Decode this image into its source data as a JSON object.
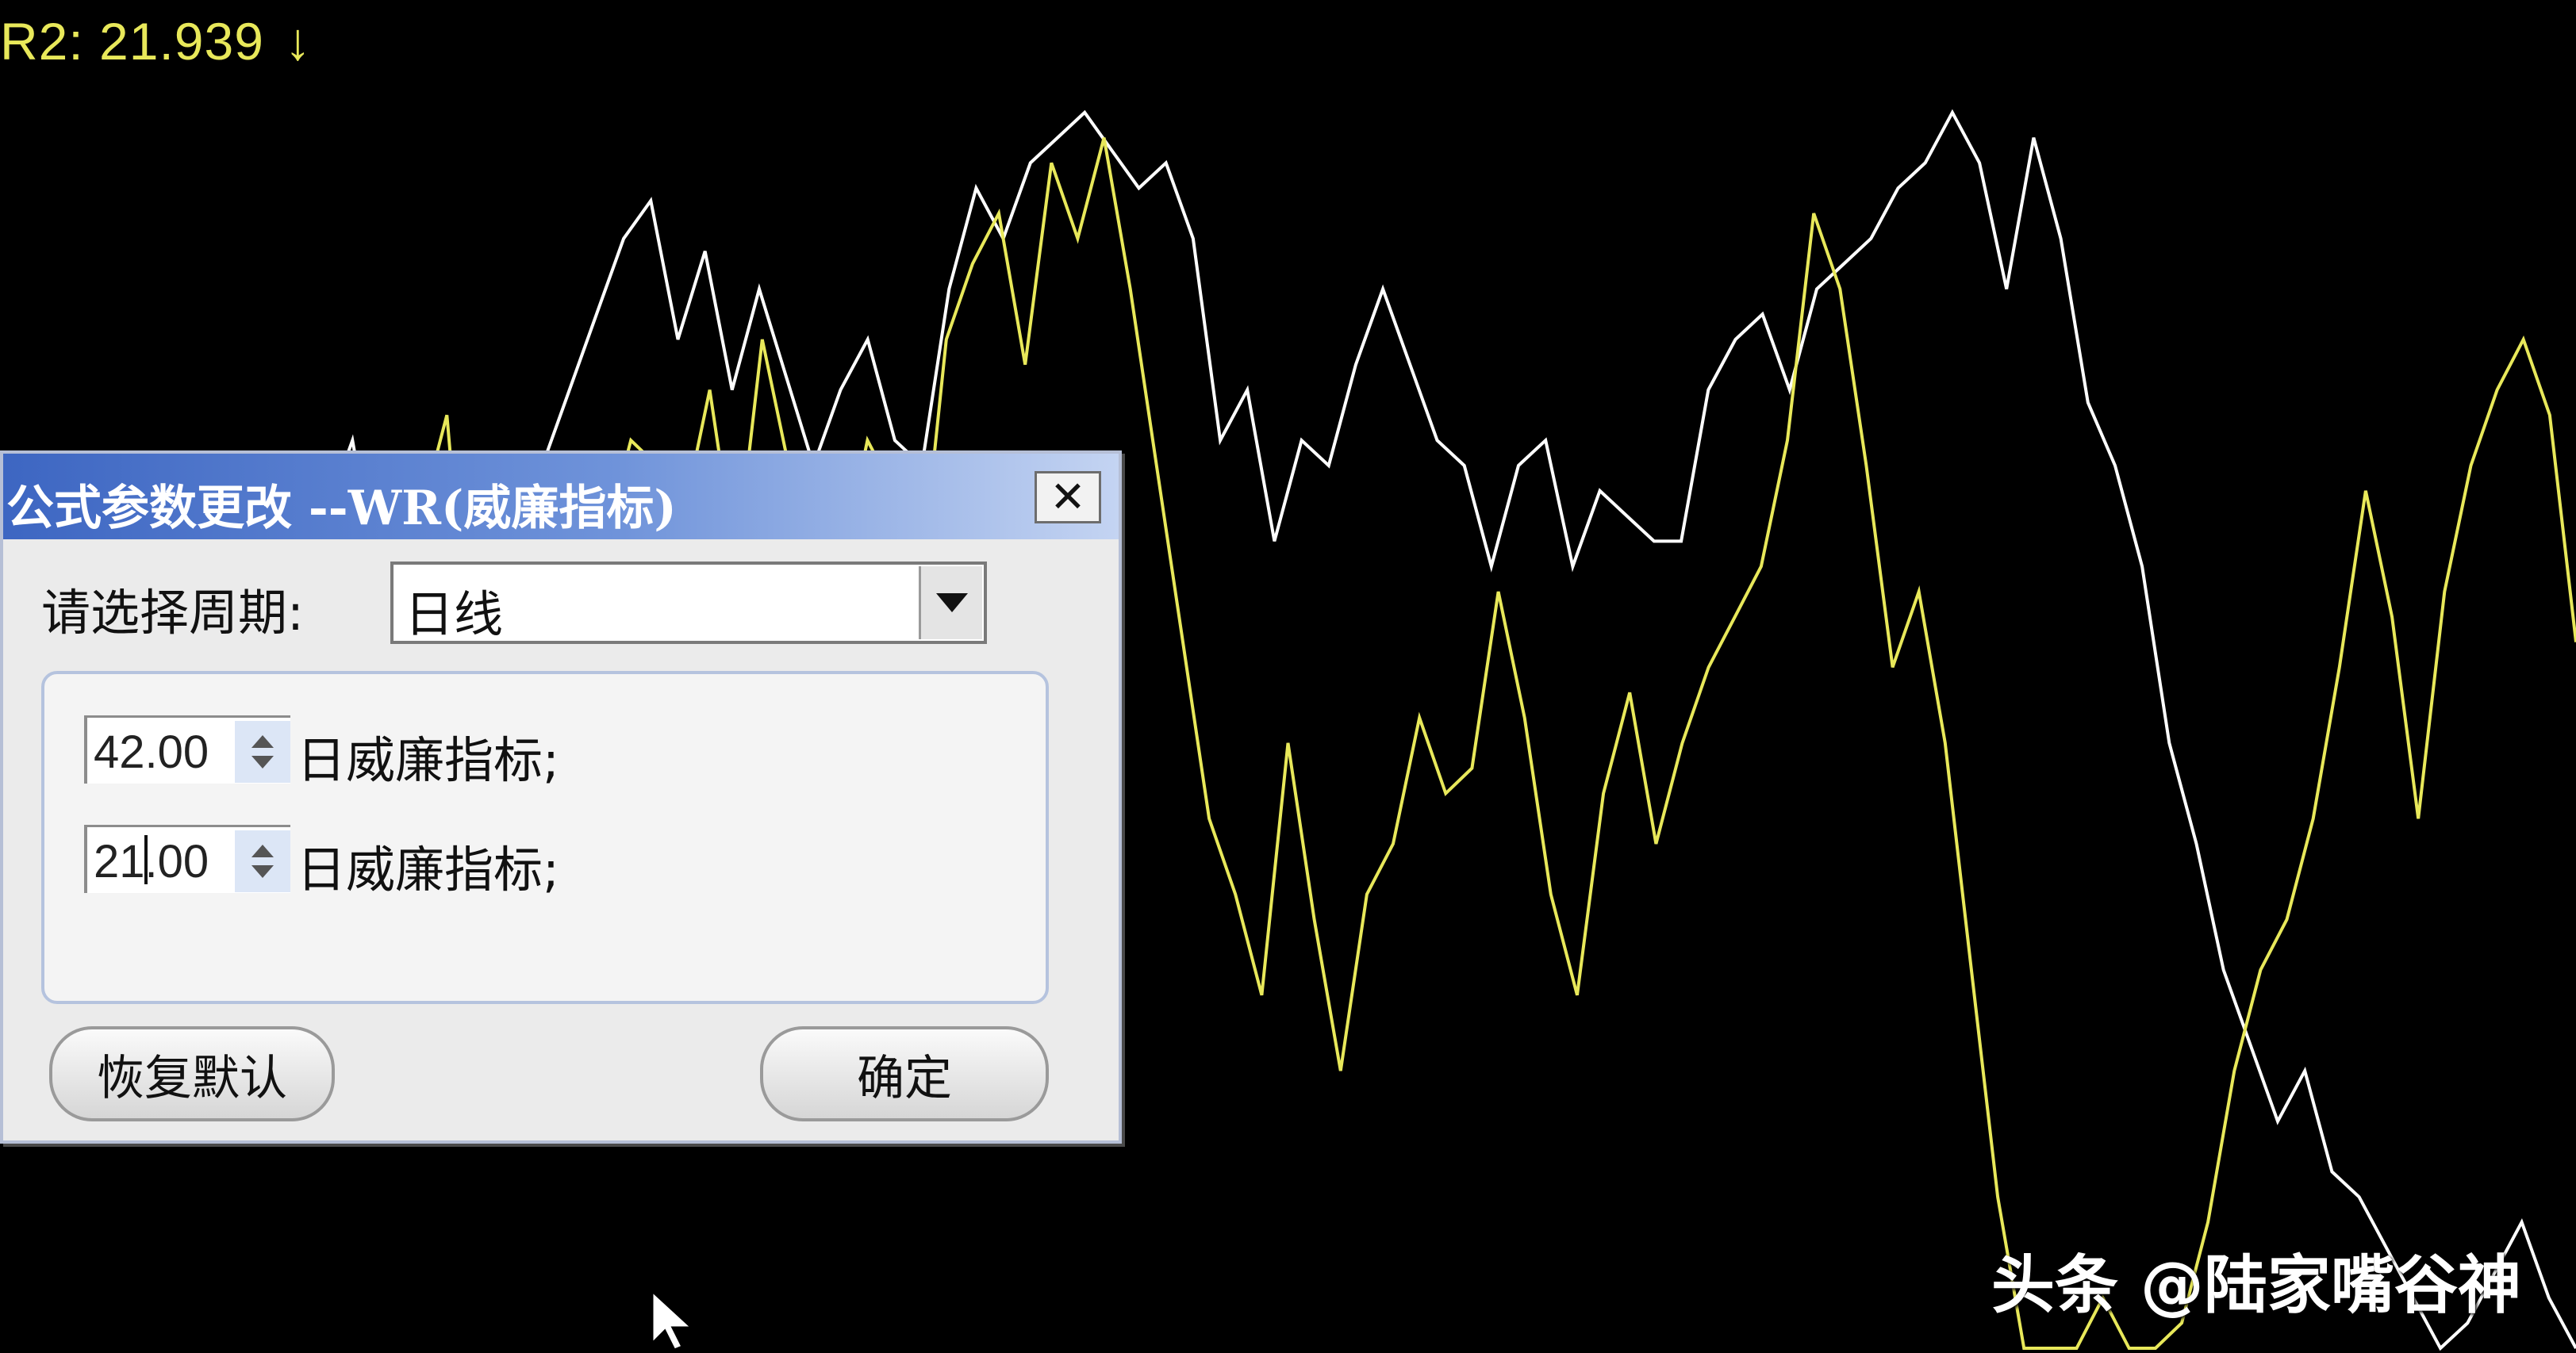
{
  "chart": {
    "readout": "R2: 21.939",
    "readout_arrow": "↓",
    "colors": {
      "background": "#000000",
      "r1_line": "#ffffff",
      "r2_line": "#e8e85a"
    },
    "r1_series": [
      20,
      24,
      28,
      30,
      34,
      38,
      42,
      46,
      48,
      36,
      42,
      56,
      66,
      72,
      60,
      68,
      52,
      46,
      56,
      64,
      70,
      76,
      82,
      88,
      91,
      80,
      87,
      76,
      84,
      77,
      70,
      76,
      80,
      72,
      70,
      84,
      92,
      88,
      94,
      96,
      98,
      95,
      92,
      94,
      88,
      72,
      76,
      64,
      72,
      70,
      78,
      84,
      78,
      72,
      70,
      62,
      70,
      72,
      62,
      68,
      66,
      64,
      64,
      76,
      80,
      82,
      76,
      84,
      86,
      88,
      92,
      94,
      98,
      94,
      84,
      96,
      88,
      75,
      70,
      62,
      48,
      40,
      30,
      24,
      18,
      22,
      14,
      12,
      8,
      4,
      0,
      2,
      6,
      10,
      4,
      0
    ],
    "r2_series": [
      30,
      36,
      38,
      44,
      46,
      48,
      50,
      64,
      48,
      40,
      30,
      36,
      40,
      56,
      62,
      48,
      66,
      74,
      50,
      36,
      40,
      46,
      56,
      64,
      72,
      70,
      66,
      76,
      62,
      80,
      70,
      64,
      62,
      72,
      68,
      60,
      80,
      86,
      90,
      78,
      94,
      88,
      96,
      84,
      70,
      56,
      42,
      36,
      28,
      48,
      34,
      22,
      36,
      40,
      50,
      44,
      46,
      60,
      50,
      36,
      28,
      44,
      52,
      40,
      48,
      54,
      58,
      62,
      72,
      90,
      84,
      70,
      54,
      60,
      48,
      30,
      12,
      0,
      0,
      0,
      4,
      0,
      0,
      2,
      10,
      22,
      30,
      34,
      42,
      54,
      68,
      58,
      42,
      60,
      70,
      76,
      80,
      74,
      56
    ]
  },
  "dialog": {
    "title": "公式参数更改 --WR(威廉指标)",
    "period_label": "请选择周期:",
    "period_value": "日线",
    "params": [
      {
        "value": "42.00",
        "label": "日威廉指标;"
      },
      {
        "value": "21.00",
        "label": "日威廉指标;"
      }
    ],
    "restore_default_label": "恢复默认",
    "ok_label": "确定"
  },
  "watermark": "头条 @陆家嘴谷神"
}
